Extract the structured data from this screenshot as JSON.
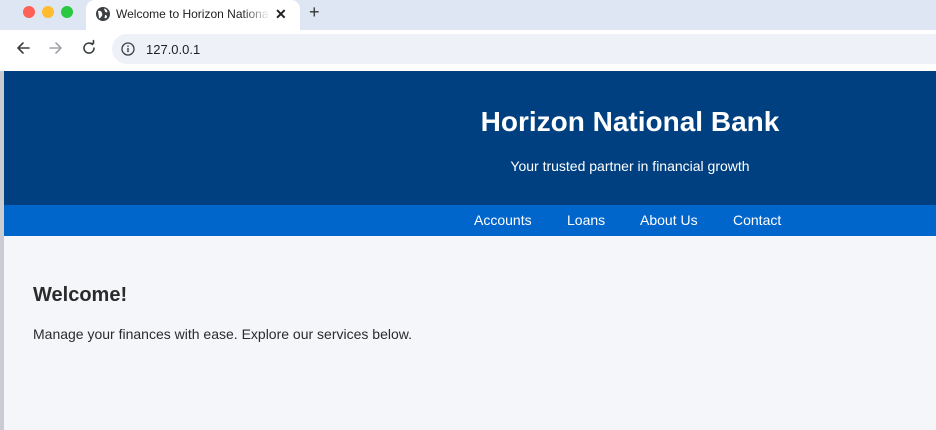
{
  "browser": {
    "tab_title": "Welcome to Horizon National Bank",
    "new_tab": "+",
    "close_glyph": "✕",
    "url": "127.0.0.1"
  },
  "site": {
    "title": "Horizon National Bank",
    "tagline": "Your trusted partner in financial growth",
    "nav": [
      "Accounts",
      "Loans",
      "About Us",
      "Contact"
    ]
  },
  "content": {
    "heading": "Welcome!",
    "text": "Manage your finances with ease. Explore our services below."
  },
  "colors": {
    "header_bg": "#004080",
    "nav_bg": "#0066cc",
    "page_bg": "#f4f6fa"
  }
}
